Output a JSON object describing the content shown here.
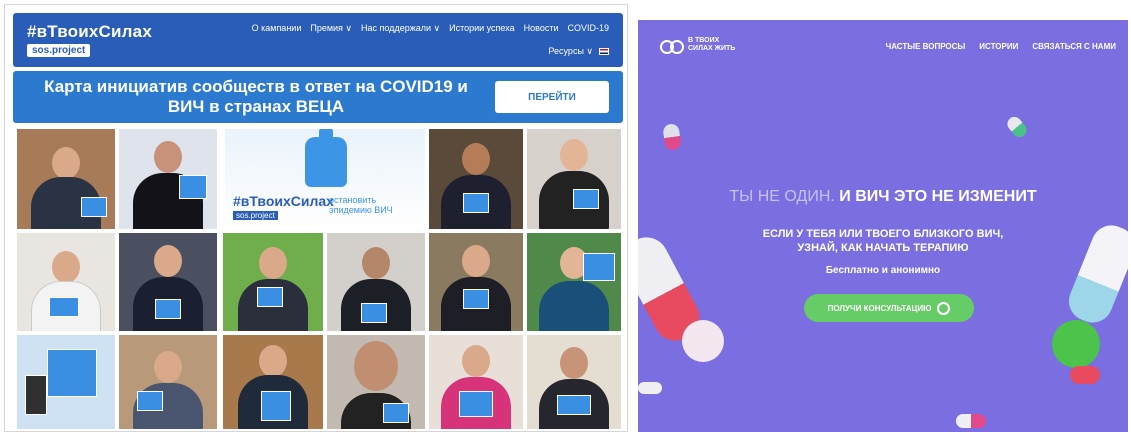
{
  "left": {
    "header": {
      "logo": "#вТвоихСилах",
      "logo_sub": "sos.project",
      "nav": [
        "О кампании",
        "Премия ∨",
        "Нас поддержали ∨",
        "Истории успеха",
        "Новости",
        "COVID-19"
      ],
      "resources": "Ресурсы ∨"
    },
    "banner": {
      "title": "Карта инициатив сообществ в ответ на COVID19 и ВИЧ в странах ВЕЦА",
      "button": "ПЕРЕЙТИ"
    },
    "center_tile": {
      "hashtag": "#вТвоихСилах",
      "slogan_1": "остановить",
      "slogan_2": "эпидемию ВИЧ",
      "sub": "sos.project"
    },
    "colors": {
      "header": "#2a5db8",
      "banner": "#2b7ad0"
    }
  },
  "right": {
    "logo_line1": "В ТВОИХ",
    "logo_line2": "СИЛАХ ЖИТЬ",
    "nav": [
      "ЧАСТЫЕ ВОПРОСЫ",
      "ИСТОРИИ",
      "СВЯЗАТЬСЯ С НАМИ"
    ],
    "headline_dim": "ТЫ НЕ ОДИН.",
    "headline_bold": " И ВИЧ ЭТО НЕ ИЗМЕНИТ",
    "sub_line1": "ЕСЛИ У ТЕБЯ ИЛИ ТВОЕГО БЛИЗКОГО ВИЧ,",
    "sub_line2": "УЗНАЙ, КАК НАЧАТЬ ТЕРАПИЮ",
    "free": "Бесплатно и анонимно",
    "cta": "ПОЛУЧИ КОНСУЛЬТАЦИЮ",
    "colors": {
      "background": "#7a6ee0",
      "cta": "#66cc66"
    }
  }
}
